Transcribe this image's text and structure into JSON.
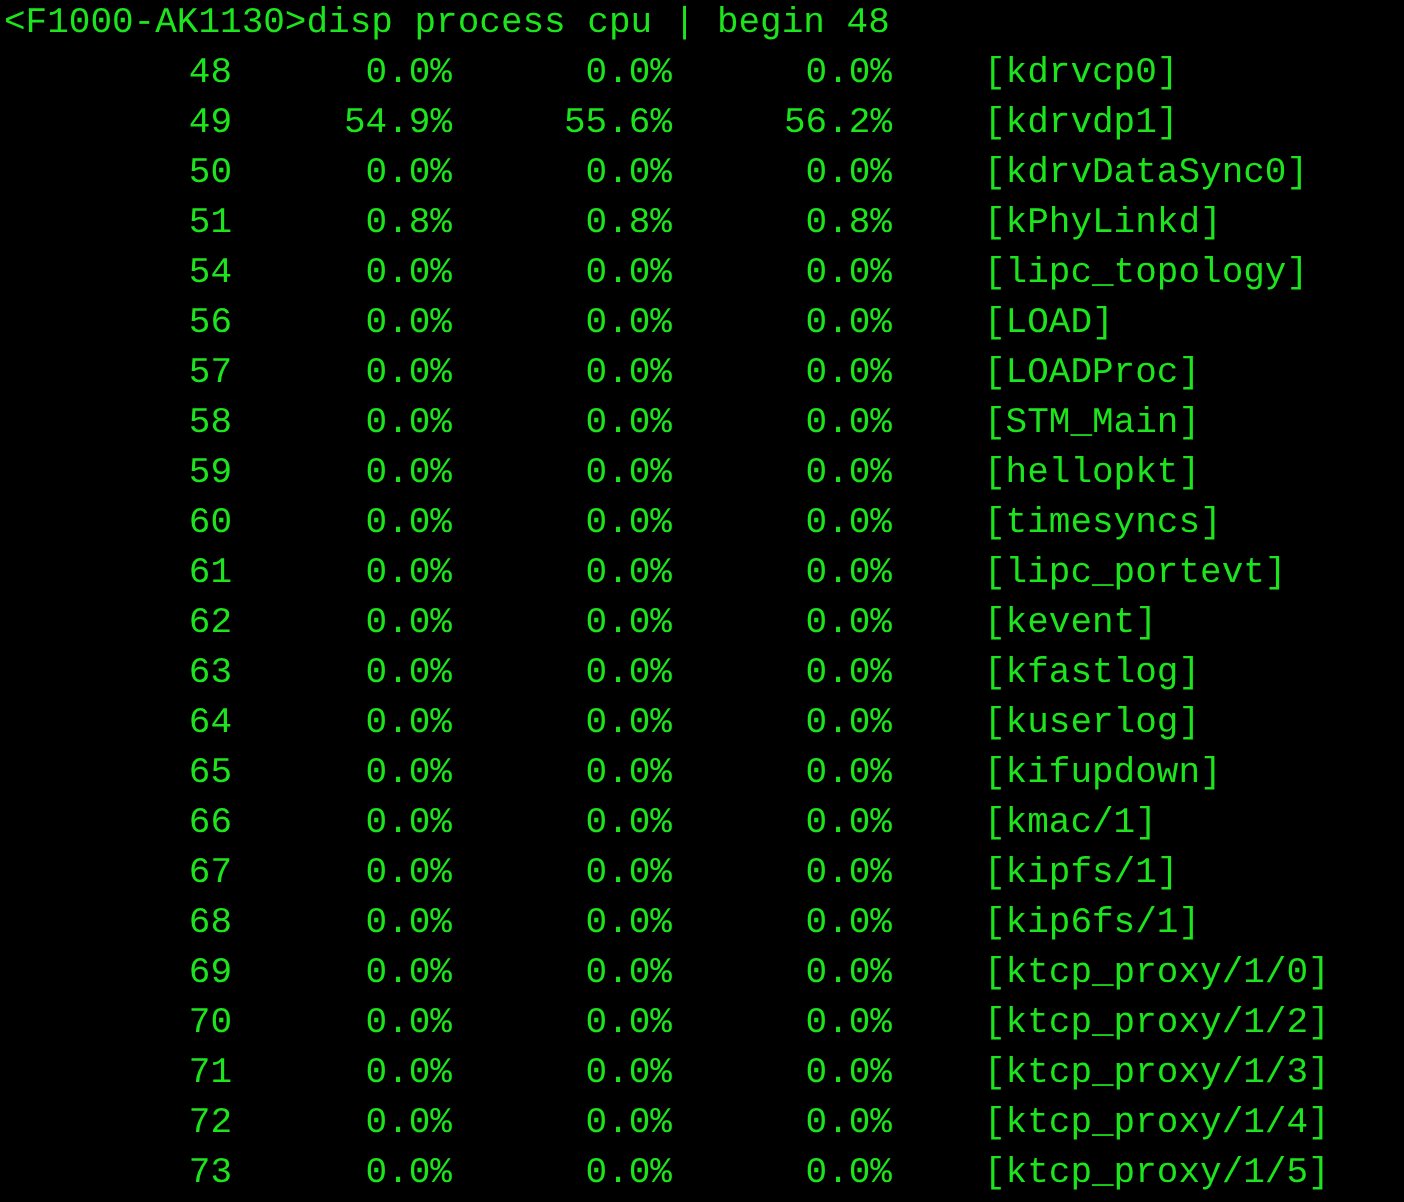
{
  "prompt": "<F1000-AK1130>disp process cpu | begin 48",
  "rows": [
    {
      "column_1": "48",
      "column_2": "0.0%",
      "column_3": "0.0%",
      "column_4": "0.0%",
      "column_5": "[kdrvcp0]"
    },
    {
      "column_1": "49",
      "column_2": "54.9%",
      "column_3": "55.6%",
      "column_4": "56.2%",
      "column_5": "[kdrvdp1]"
    },
    {
      "column_1": "50",
      "column_2": "0.0%",
      "column_3": "0.0%",
      "column_4": "0.0%",
      "column_5": "[kdrvDataSync0]"
    },
    {
      "column_1": "51",
      "column_2": "0.8%",
      "column_3": "0.8%",
      "column_4": "0.8%",
      "column_5": "[kPhyLinkd]"
    },
    {
      "column_1": "54",
      "column_2": "0.0%",
      "column_3": "0.0%",
      "column_4": "0.0%",
      "column_5": "[lipc_topology]"
    },
    {
      "column_1": "56",
      "column_2": "0.0%",
      "column_3": "0.0%",
      "column_4": "0.0%",
      "column_5": "[LOAD]"
    },
    {
      "column_1": "57",
      "column_2": "0.0%",
      "column_3": "0.0%",
      "column_4": "0.0%",
      "column_5": "[LOADProc]"
    },
    {
      "column_1": "58",
      "column_2": "0.0%",
      "column_3": "0.0%",
      "column_4": "0.0%",
      "column_5": "[STM_Main]"
    },
    {
      "column_1": "59",
      "column_2": "0.0%",
      "column_3": "0.0%",
      "column_4": "0.0%",
      "column_5": "[hellopkt]"
    },
    {
      "column_1": "60",
      "column_2": "0.0%",
      "column_3": "0.0%",
      "column_4": "0.0%",
      "column_5": "[timesyncs]"
    },
    {
      "column_1": "61",
      "column_2": "0.0%",
      "column_3": "0.0%",
      "column_4": "0.0%",
      "column_5": "[lipc_portevt]"
    },
    {
      "column_1": "62",
      "column_2": "0.0%",
      "column_3": "0.0%",
      "column_4": "0.0%",
      "column_5": "[kevent]"
    },
    {
      "column_1": "63",
      "column_2": "0.0%",
      "column_3": "0.0%",
      "column_4": "0.0%",
      "column_5": "[kfastlog]"
    },
    {
      "column_1": "64",
      "column_2": "0.0%",
      "column_3": "0.0%",
      "column_4": "0.0%",
      "column_5": "[kuserlog]"
    },
    {
      "column_1": "65",
      "column_2": "0.0%",
      "column_3": "0.0%",
      "column_4": "0.0%",
      "column_5": "[kifupdown]"
    },
    {
      "column_1": "66",
      "column_2": "0.0%",
      "column_3": "0.0%",
      "column_4": "0.0%",
      "column_5": "[kmac/1]"
    },
    {
      "column_1": "67",
      "column_2": "0.0%",
      "column_3": "0.0%",
      "column_4": "0.0%",
      "column_5": "[kipfs/1]"
    },
    {
      "column_1": "68",
      "column_2": "0.0%",
      "column_3": "0.0%",
      "column_4": "0.0%",
      "column_5": "[kip6fs/1]"
    },
    {
      "column_1": "69",
      "column_2": "0.0%",
      "column_3": "0.0%",
      "column_4": "0.0%",
      "column_5": "[ktcp_proxy/1/0]"
    },
    {
      "column_1": "70",
      "column_2": "0.0%",
      "column_3": "0.0%",
      "column_4": "0.0%",
      "column_5": "[ktcp_proxy/1/2]"
    },
    {
      "column_1": "71",
      "column_2": "0.0%",
      "column_3": "0.0%",
      "column_4": "0.0%",
      "column_5": "[ktcp_proxy/1/3]"
    },
    {
      "column_1": "72",
      "column_2": "0.0%",
      "column_3": "0.0%",
      "column_4": "0.0%",
      "column_5": "[ktcp_proxy/1/4]"
    },
    {
      "column_1": "73",
      "column_2": "0.0%",
      "column_3": "0.0%",
      "column_4": "0.0%",
      "column_5": "[ktcp_proxy/1/5]"
    }
  ]
}
